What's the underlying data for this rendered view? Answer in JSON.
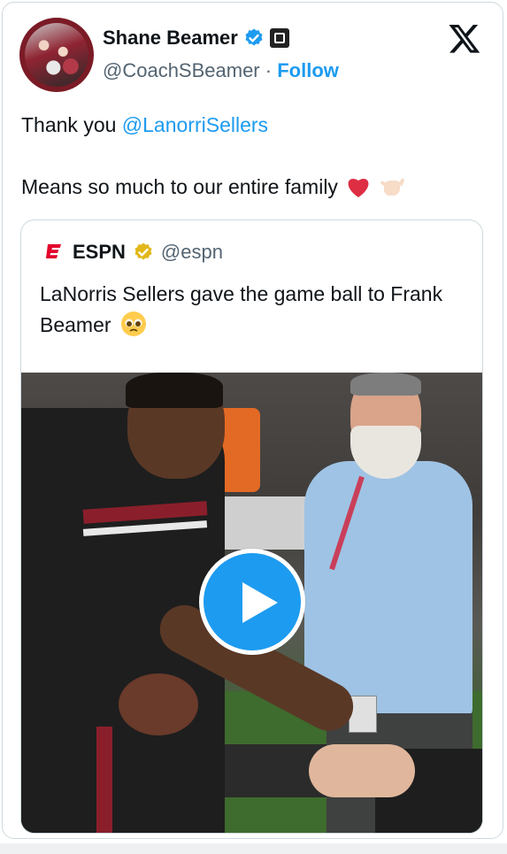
{
  "author": {
    "display_name": "Shane Beamer",
    "handle": "@CoachSBeamer",
    "separator": "·",
    "follow_label": "Follow"
  },
  "tweet": {
    "text_prefix": "Thank you ",
    "mention": "@LanorriSellers",
    "line2": "Means so much to our entire family"
  },
  "quoted": {
    "name": "ESPN",
    "handle": "@espn",
    "text": "LaNorris Sellers gave the game ball to Frank Beamer"
  },
  "colors": {
    "accent": "#1d9bf0",
    "text": "#0f1419",
    "muted": "#536471",
    "espn_red": "#e4002b",
    "gold": "#e2b719"
  },
  "icons": [
    "verified-badge-icon",
    "team-logo-icon",
    "x-logo-icon",
    "heart-emoji",
    "call-me-hand-emoji",
    "espn-logo-icon",
    "gold-check-badge-icon",
    "pleading-face-emoji",
    "play-icon"
  ]
}
